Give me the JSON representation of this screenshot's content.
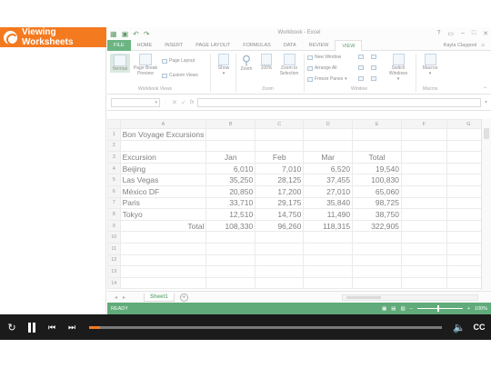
{
  "lesson": {
    "title": "Viewing Worksheets"
  },
  "excel": {
    "window_title": "Workbook - Excel",
    "tabs": [
      "FILE",
      "HOME",
      "INSERT",
      "PAGE LAYOUT",
      "FORMULAS",
      "DATA",
      "REVIEW",
      "VIEW"
    ],
    "active_tab": "VIEW",
    "user": "Kayla Claypool",
    "ribbon": {
      "workbook_views": {
        "label": "Workbook Views",
        "normal": "Normal",
        "page_break": "Page Break Preview",
        "page_layout": "Page Layout",
        "custom_views": "Custom Views"
      },
      "show": {
        "label": "Show"
      },
      "zoom": {
        "label": "Zoom",
        "zoom": "Zoom",
        "hundred": "100%",
        "zoom_to_selection": "Zoom to Selection"
      },
      "window": {
        "label": "Window",
        "new_window": "New Window",
        "arrange_all": "Arrange All",
        "freeze_panes": "Freeze Panes",
        "switch_windows": "Switch Windows"
      },
      "macros": {
        "label": "Macros",
        "macros": "Macros"
      }
    },
    "formula_bar": {
      "fx": "fx"
    },
    "columns": [
      "A",
      "B",
      "C",
      "D",
      "E",
      "F",
      "G"
    ],
    "rows": [
      {
        "n": "1",
        "cells": [
          "Bon Voyage Excursions",
          "",
          "",
          "",
          "",
          "",
          ""
        ]
      },
      {
        "n": "2",
        "cells": [
          "",
          "",
          "",
          "",
          "",
          "",
          ""
        ]
      },
      {
        "n": "3",
        "cells": [
          "Excursion",
          "Jan",
          "Feb",
          "Mar",
          "Total",
          "",
          ""
        ]
      },
      {
        "n": "4",
        "cells": [
          "Beijing",
          "6,010",
          "7,010",
          "6,520",
          "19,540",
          "",
          ""
        ]
      },
      {
        "n": "5",
        "cells": [
          "Las Vegas",
          "35,250",
          "28,125",
          "37,455",
          "100,830",
          "",
          ""
        ]
      },
      {
        "n": "6",
        "cells": [
          "México DF",
          "20,850",
          "17,200",
          "27,010",
          "65,060",
          "",
          ""
        ]
      },
      {
        "n": "7",
        "cells": [
          "Paris",
          "33,710",
          "29,175",
          "35,840",
          "98,725",
          "",
          ""
        ]
      },
      {
        "n": "8",
        "cells": [
          "Tokyo",
          "12,510",
          "14,750",
          "11,490",
          "38,750",
          "",
          ""
        ]
      },
      {
        "n": "9",
        "cells": [
          "Total",
          "108,330",
          "96,260",
          "118,315",
          "322,905",
          "",
          ""
        ]
      },
      {
        "n": "10",
        "cells": [
          "",
          "",
          "",
          "",
          "",
          "",
          ""
        ]
      },
      {
        "n": "11",
        "cells": [
          "",
          "",
          "",
          "",
          "",
          "",
          ""
        ]
      },
      {
        "n": "12",
        "cells": [
          "",
          "",
          "",
          "",
          "",
          "",
          ""
        ]
      },
      {
        "n": "13",
        "cells": [
          "",
          "",
          "",
          "",
          "",
          "",
          ""
        ]
      },
      {
        "n": "14",
        "cells": [
          "",
          "",
          "",
          "",
          "",
          "",
          ""
        ]
      }
    ],
    "sheet_tab": "Sheet1",
    "status": {
      "ready": "READY",
      "zoom": "100%"
    }
  },
  "player": {
    "progress": 0.03,
    "cc": "CC",
    "accent": "#f47a20"
  }
}
